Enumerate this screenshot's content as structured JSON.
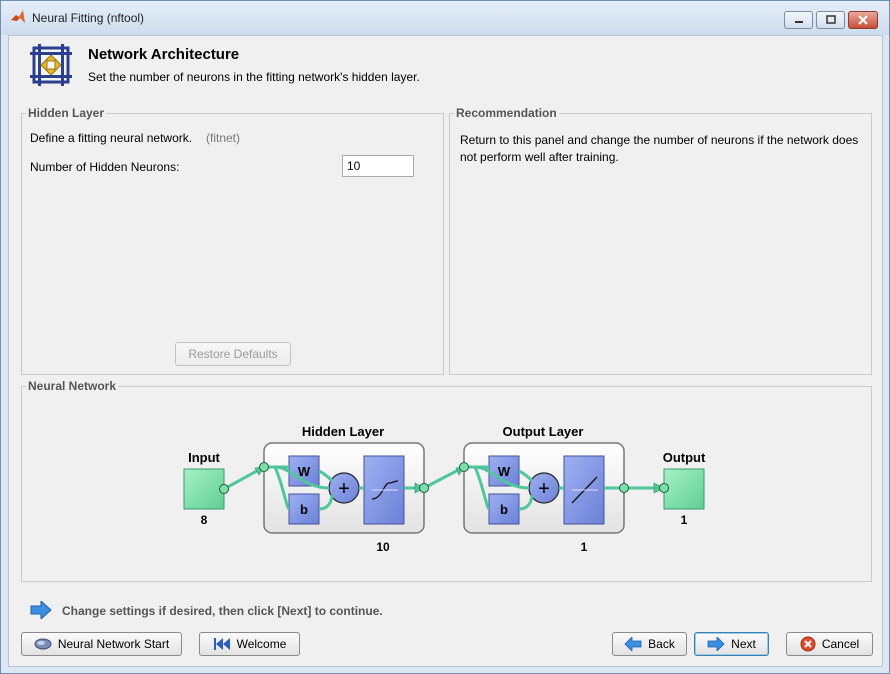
{
  "window": {
    "title": "Neural Fitting (nftool)"
  },
  "header": {
    "title": "Network Architecture",
    "subtitle": "Set the number of neurons in the fitting network's hidden layer."
  },
  "hidden_layer": {
    "group_label": "Hidden Layer",
    "define_text": "Define a fitting neural network.",
    "fitnet": "(fitnet)",
    "neurons_label": "Number of Hidden Neurons:",
    "neurons_value": "10",
    "restore_label": "Restore Defaults"
  },
  "recommendation": {
    "group_label": "Recommendation",
    "text_line1": "Return to this panel and change the number of neurons if the network does",
    "text_line2": "not perform well after training."
  },
  "network": {
    "group_label": "Neural Network",
    "input_label": "Input",
    "input_size": "8",
    "hidden_label": "Hidden Layer",
    "hidden_size": "10",
    "output_layer_label": "Output Layer",
    "output_layer_size": "1",
    "output_label": "Output",
    "output_size": "1",
    "w_label": "W",
    "b_label": "b",
    "plus": "+"
  },
  "hint": {
    "text": "Change settings  if desired, then click [Next] to continue."
  },
  "buttons": {
    "start": "Neural Network Start",
    "welcome": "Welcome",
    "back": "Back",
    "next": "Next",
    "cancel": "Cancel"
  },
  "colors": {
    "neuron_box": "#7f96e6",
    "io_box": "#7de0a8",
    "arrow": "#4fc79a"
  }
}
